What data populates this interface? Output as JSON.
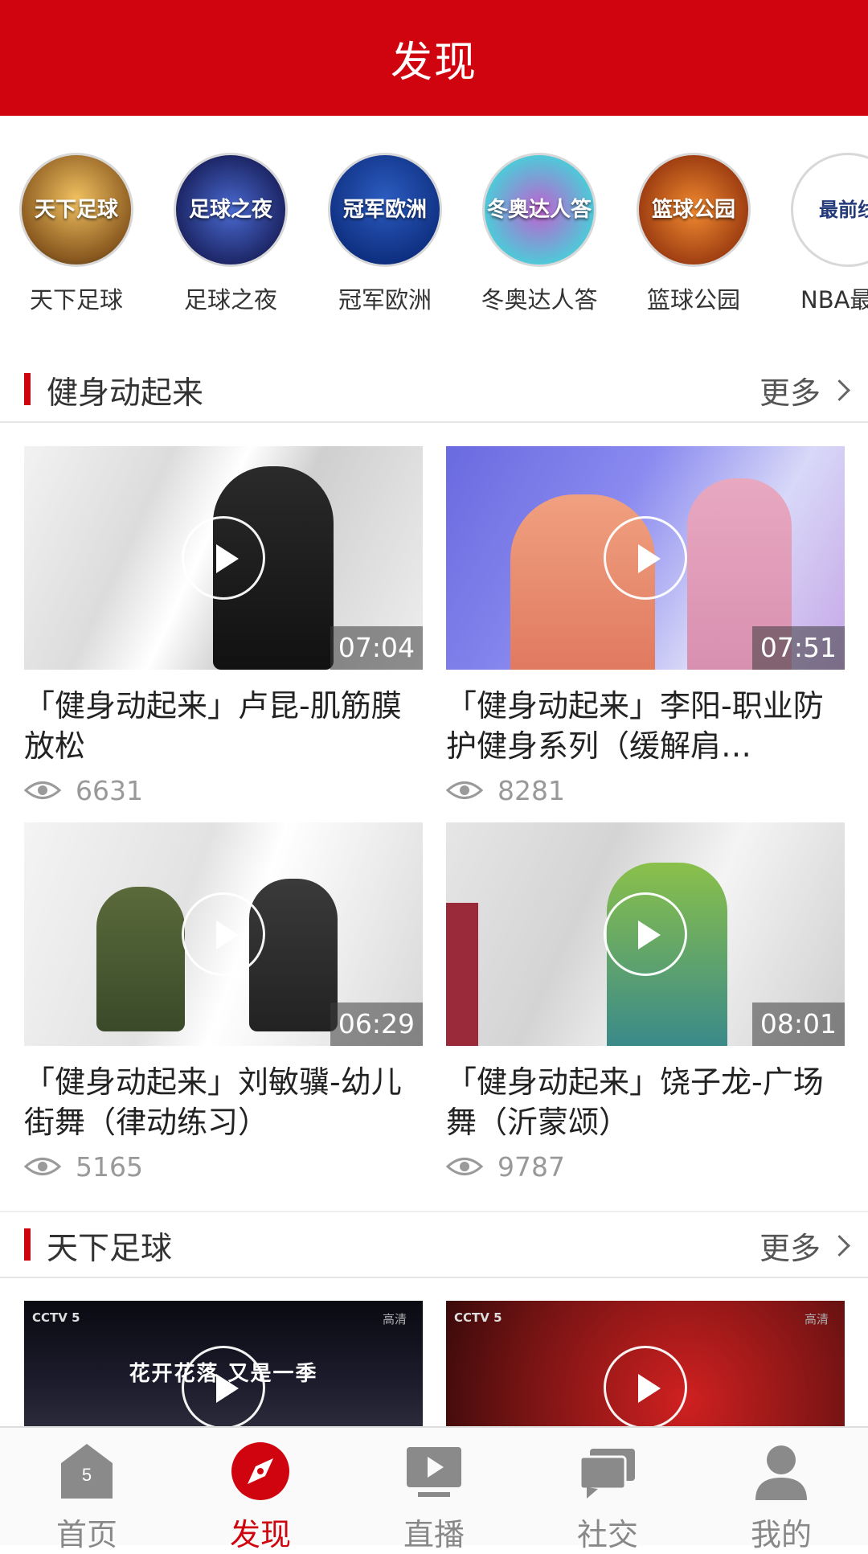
{
  "header": {
    "title": "发现"
  },
  "channels": [
    {
      "name": "天下足球",
      "logo_text": "天下足球",
      "color": "#9a6a2a"
    },
    {
      "name": "足球之夜",
      "logo_text": "足球之夜",
      "color": "#1f2f7a"
    },
    {
      "name": "冠军欧洲",
      "logo_text": "冠军欧洲",
      "color": "#1440a0"
    },
    {
      "name": "冬奥达人答",
      "logo_text": "冬奥达人答",
      "color": "#4ec7d6"
    },
    {
      "name": "篮球公园",
      "logo_text": "篮球公园",
      "color": "#c2571a"
    },
    {
      "name": "NBA最",
      "logo_text": "最前线",
      "color": "#243a7a"
    }
  ],
  "sections": [
    {
      "title": "健身动起来",
      "more": "更多"
    },
    {
      "title": "天下足球",
      "more": "更多"
    }
  ],
  "videos": [
    {
      "title": "「健身动起来」卢昆-肌筋膜放松",
      "duration": "07:04",
      "views": "6631"
    },
    {
      "title": "「健身动起来」李阳-职业防护健身系列（缓解肩…",
      "duration": "07:51",
      "views": "8281"
    },
    {
      "title": "「健身动起来」刘敏骥-幼儿街舞（律动练习）",
      "duration": "06:29",
      "views": "5165"
    },
    {
      "title": "「健身动起来」饶子龙-广场舞（沂蒙颂）",
      "duration": "08:01",
      "views": "9787"
    }
  ],
  "football_videos": [
    {
      "caption": "花开花落 又是一季",
      "channel_mark": "CCTV 5",
      "hd": "高清"
    },
    {
      "caption": "",
      "channel_mark": "CCTV 5",
      "hd": "高清"
    }
  ],
  "tabs": [
    {
      "label": "首页",
      "icon": "home-icon",
      "badge": "5",
      "active": false
    },
    {
      "label": "发现",
      "icon": "compass-icon",
      "active": true
    },
    {
      "label": "直播",
      "icon": "live-play-icon",
      "active": false
    },
    {
      "label": "社交",
      "icon": "chat-icon",
      "active": false
    },
    {
      "label": "我的",
      "icon": "user-icon",
      "active": false
    }
  ],
  "colors": {
    "brand": "#d0040e",
    "active_tab": "#d0040e",
    "inactive_tab": "#888888"
  }
}
